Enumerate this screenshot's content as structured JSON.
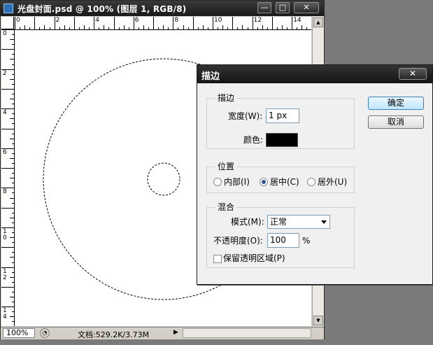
{
  "document": {
    "title": "光盘封面.psd @ 100% (图层 1, RGB/8)",
    "window_buttons": {
      "minimize": "—",
      "maximize": "□",
      "close": "✕"
    },
    "ruler_h_numbers": [
      "0",
      "2",
      "4",
      "6",
      "8",
      "10",
      "12",
      "14"
    ],
    "ruler_v_numbers": [
      "0",
      "2",
      "4",
      "6",
      "8",
      "1\n0",
      "1\n2",
      "1\n4"
    ],
    "status": {
      "zoom": "100%",
      "doc_info": "文档:529.2K/3.73M"
    }
  },
  "dialog": {
    "title": "描边",
    "close_label": "✕",
    "stroke_group": {
      "label": "描边",
      "width_label": "宽度(W):",
      "width_value": "1 px",
      "color_label": "颜色:",
      "color_value": "#000000"
    },
    "position_group": {
      "label": "位置",
      "options": [
        "内部(I)",
        "居中(C)",
        "居外(U)"
      ],
      "selected": "居中(C)"
    },
    "blend_group": {
      "label": "混合",
      "mode_label": "模式(M):",
      "mode_value": "正常",
      "opacity_label": "不透明度(O):",
      "opacity_value": "100",
      "opacity_unit": "%",
      "preserve_label": "保留透明区域(P)",
      "preserve_checked": false
    },
    "ok_label": "确定",
    "cancel_label": "取消"
  },
  "colors": {
    "accent_selected_radio": "#2a5596",
    "default_button": "#bee6fd"
  }
}
